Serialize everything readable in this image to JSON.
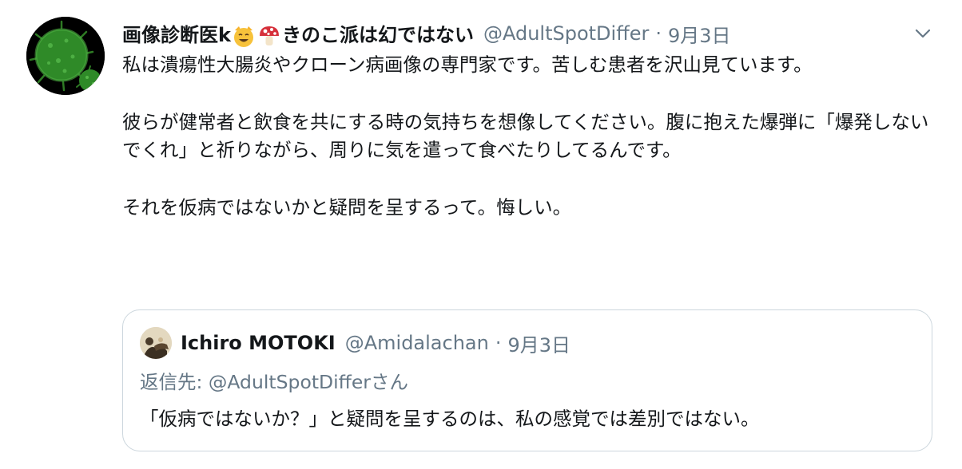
{
  "tweet": {
    "author": {
      "name_part1": "画像診断医k",
      "name_part2": "きのこ派は幻ではない",
      "emoji_1": "smiling-cat-face-icon",
      "emoji_2": "mushroom-icon",
      "handle": "@AdultSpotDiffer",
      "separator": "·",
      "date": "9月3日"
    },
    "menu_icon": "chevron-down-icon",
    "paragraphs": [
      "私は潰瘍性大腸炎やクローン病画像の専門家です。苦しむ患者を沢山見ています。",
      "彼らが健常者と飲食を共にする時の気持ちを想像してください。腹に抱えた爆弾に「爆発しないでくれ」と祈りながら、周りに気を遣って食べたりしてるんです。",
      "それを仮病ではないかと疑問を呈するって。悔しい。"
    ],
    "quoted": {
      "name": "Ichiro MOTOKI",
      "handle": "@Amidalachan",
      "separator": "·",
      "date": "9月3日",
      "replying_to": "返信先: @AdultSpotDifferさん",
      "text": "「仮病ではないか？」と疑問を呈するのは、私の感覚では差別ではない。"
    }
  },
  "colors": {
    "primary_text": "#14171a",
    "secondary_text": "#657786",
    "border": "#ccd6dd",
    "avatar_bg": "#000000",
    "avatar_virus": "#3a8f2e"
  }
}
